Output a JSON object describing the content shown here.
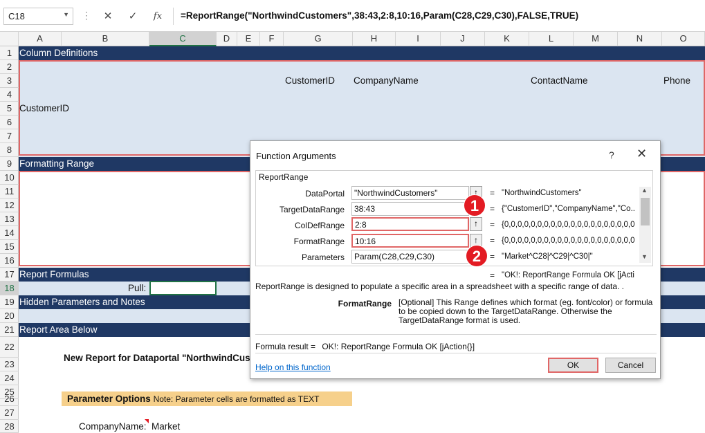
{
  "formula_bar": {
    "name_box": "C18",
    "cancel_icon": "✕",
    "enter_icon": "✓",
    "fx_label": "fx",
    "formula": "=ReportRange(\"NorthwindCustomers\",38:43,2:8,10:16,Param(C28,C29,C30),FALSE,TRUE)"
  },
  "columns": [
    "A",
    "B",
    "C",
    "D",
    "E",
    "F",
    "G",
    "H",
    "I",
    "J",
    "K",
    "L",
    "M",
    "N",
    "O"
  ],
  "rows": [
    "1",
    "2",
    "3",
    "4",
    "5",
    "6",
    "7",
    "8",
    "9",
    "10",
    "11",
    "12",
    "13",
    "14",
    "15",
    "16",
    "17",
    "18",
    "19",
    "20",
    "21",
    "22",
    "23",
    "24",
    "25",
    "26",
    "27",
    "28"
  ],
  "sheet": {
    "band_column_definitions": "Column Definitions",
    "band_formatting_range": "Formatting Range",
    "band_report_formulas": "Report Formulas",
    "band_hidden_params": "Hidden Parameters and Notes",
    "band_report_area": "Report Area Below",
    "col_customerid": "CustomerID",
    "col_companyname": "CompanyName",
    "col_contactname": "ContactName",
    "col_phone": "Phone",
    "row5_customerid": "CustomerID",
    "pull_label": "Pull:",
    "new_report_title": "New Report for Dataportal \"NorthwindCusto",
    "param_options_bold": "Parameter Options",
    "param_options_note": "Note: Parameter cells are formatted as TEXT",
    "companyname_label": "CompanyName:",
    "companyname_value": "Market"
  },
  "dialog": {
    "title": "Function Arguments",
    "help_glyph": "?",
    "close_glyph": "✕",
    "function_name": "ReportRange",
    "args": [
      {
        "label": "DataPortal",
        "input": "\"NorthwindCustomers\"",
        "value": "\"NorthwindCustomers\""
      },
      {
        "label": "TargetDataRange",
        "input": "38:43",
        "value": "{\"CustomerID\",\"CompanyName\",\"Co..."
      },
      {
        "label": "ColDefRange",
        "input": "2:8",
        "value": "{0,0,0,0,0,0,0,0,0,0,0,0,0,0,0,0,0,0,0,0,0"
      },
      {
        "label": "FormatRange",
        "input": "10:16",
        "value": "{0,0,0,0,0,0,0,0,0,0,0,0,0,0,0,0,0,0,0,0,0"
      },
      {
        "label": "Parameters",
        "input": "Param(C28,C29,C30)",
        "value": "\"Market^C28|^C29|^C30|\""
      }
    ],
    "eq": "=",
    "result_value": "\"OK!: ReportRange Formula OK [jActi",
    "description": "ReportRange is designed to populate a specific area in a spreadsheet with a specific range of data. .",
    "arg_name": "FormatRange",
    "arg_desc": "[Optional] This Range defines which format (eg. font/color) or formula to be copied down to the TargetDataRange. Otherwise the TargetDataRange format is used.",
    "formula_result_label": "Formula result =",
    "formula_result_value": "OK!: ReportRange Formula OK [jAction{}]",
    "help_link": "Help on this function",
    "ok_label": "OK",
    "cancel_label": "Cancel"
  },
  "badges": {
    "one": "1",
    "two": "2"
  },
  "colors": {
    "band": "#1f3864",
    "light_blue": "#dbe5f1",
    "highlight_red": "#e06666",
    "badge_red": "#e31b23",
    "param_orange": "#f6d08b",
    "excel_green": "#217346"
  }
}
